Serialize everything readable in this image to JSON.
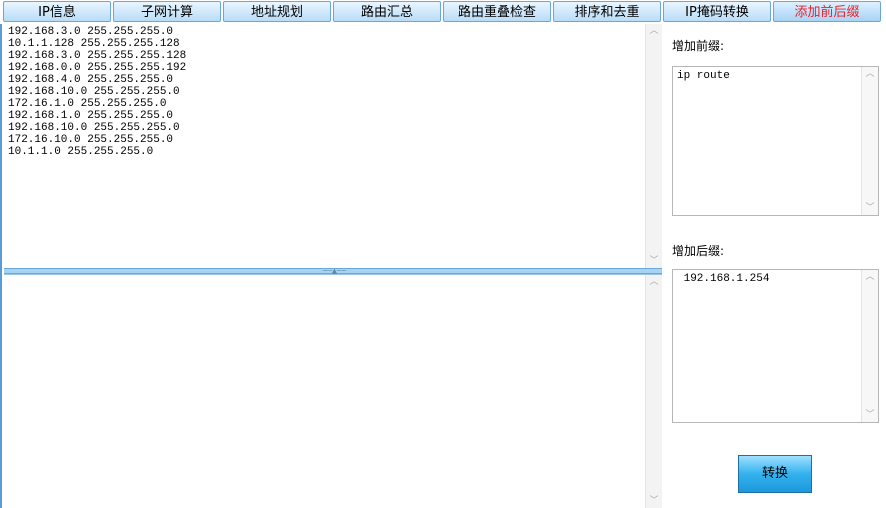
{
  "tabs": [
    {
      "label": "IP信息"
    },
    {
      "label": "子网计算"
    },
    {
      "label": "地址规划"
    },
    {
      "label": "路由汇总"
    },
    {
      "label": "路由重叠检查"
    },
    {
      "label": "排序和去重"
    },
    {
      "label": "IP掩码转换"
    },
    {
      "label": "添加前后缀"
    }
  ],
  "active_tab_index": 7,
  "input_text": "192.168.3.0 255.255.255.0\n10.1.1.128 255.255.255.128\n192.168.3.0 255.255.255.128\n192.168.0.0 255.255.255.192\n192.168.4.0 255.255.255.0\n192.168.10.0 255.255.255.0\n172.16.1.0 255.255.255.0\n192.168.1.0 255.255.255.0\n192.168.10.0 255.255.255.0\n172.16.10.0 255.255.255.0\n10.1.1.0 255.255.255.0",
  "output_text": "",
  "prefix": {
    "label": "增加前缀:",
    "value": "ip route"
  },
  "suffix": {
    "label": "增加后缀:",
    "value": " 192.168.1.254"
  },
  "convert_button": "转换",
  "colors": {
    "active_tab_text": "#e8232b",
    "tab_border": "#6aa8d8",
    "button": "#1c98dc"
  }
}
